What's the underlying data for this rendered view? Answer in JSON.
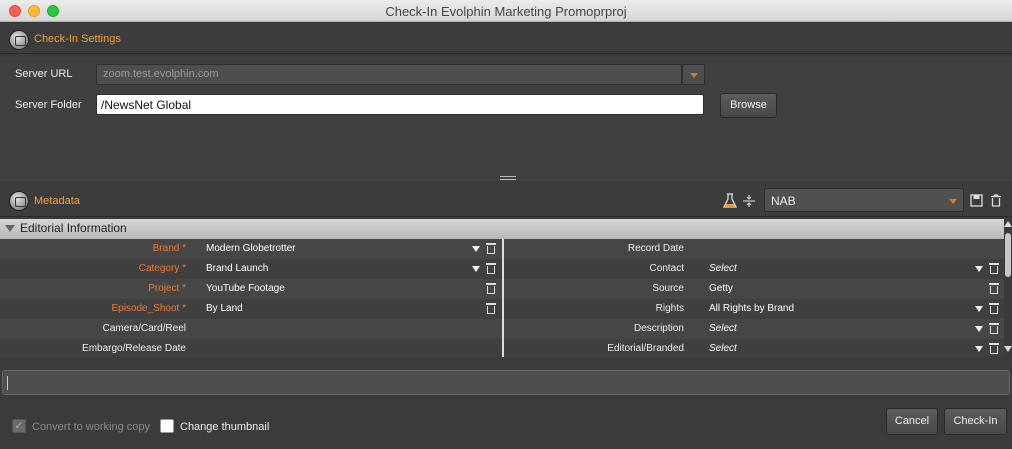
{
  "window": {
    "title": "Check-In Evolphin Marketing Promoprproj"
  },
  "checkin_settings": {
    "title": "Check-In Settings",
    "server_url_label": "Server URL",
    "server_url_value": "zoom.test.evolphin.com",
    "server_folder_label": "Server Folder",
    "server_folder_value": "/NewsNet Global",
    "browse_label": "Browse"
  },
  "metadata": {
    "title": "Metadata",
    "template_value": "NAB",
    "group_title": "Editorial Information",
    "left_rows": [
      {
        "label": "Brand *",
        "value": "Modern Globetrotter",
        "required": true,
        "dropdown": true,
        "trash": true
      },
      {
        "label": "Category *",
        "value": "Brand Launch",
        "required": true,
        "dropdown": true,
        "trash": true
      },
      {
        "label": "Project *",
        "value": "YouTube Footage",
        "required": true,
        "dropdown": false,
        "trash": true
      },
      {
        "label": "Episode_Shoot *",
        "value": "By Land",
        "required": true,
        "dropdown": false,
        "trash": true
      },
      {
        "label": "Camera/Card/Reel",
        "value": "",
        "required": false,
        "dropdown": false,
        "trash": false
      },
      {
        "label": "Embargo/Release Date",
        "value": "",
        "required": false,
        "dropdown": false,
        "trash": false
      }
    ],
    "right_rows": [
      {
        "label": "Record Date",
        "value": "",
        "italic": false,
        "dropdown": false,
        "trash": false
      },
      {
        "label": "Contact",
        "value": "Select",
        "italic": true,
        "dropdown": true,
        "trash": true
      },
      {
        "label": "Source",
        "value": "Getty",
        "italic": false,
        "dropdown": false,
        "trash": true
      },
      {
        "label": "Rights",
        "value": "All Rights by Brand",
        "italic": false,
        "dropdown": true,
        "trash": true
      },
      {
        "label": "Description",
        "value": "Select",
        "italic": true,
        "dropdown": true,
        "trash": true
      },
      {
        "label": "Editorial/Branded",
        "value": "Select",
        "italic": true,
        "dropdown": true,
        "trash": true
      }
    ]
  },
  "footer": {
    "convert_label": "Convert to working copy",
    "convert_checked": true,
    "thumbnail_label": "Change thumbnail",
    "thumbnail_checked": false,
    "cancel_label": "Cancel",
    "checkin_label": "Check-In"
  },
  "colors": {
    "accent": "#f0a23a",
    "required": "#f07a30"
  }
}
